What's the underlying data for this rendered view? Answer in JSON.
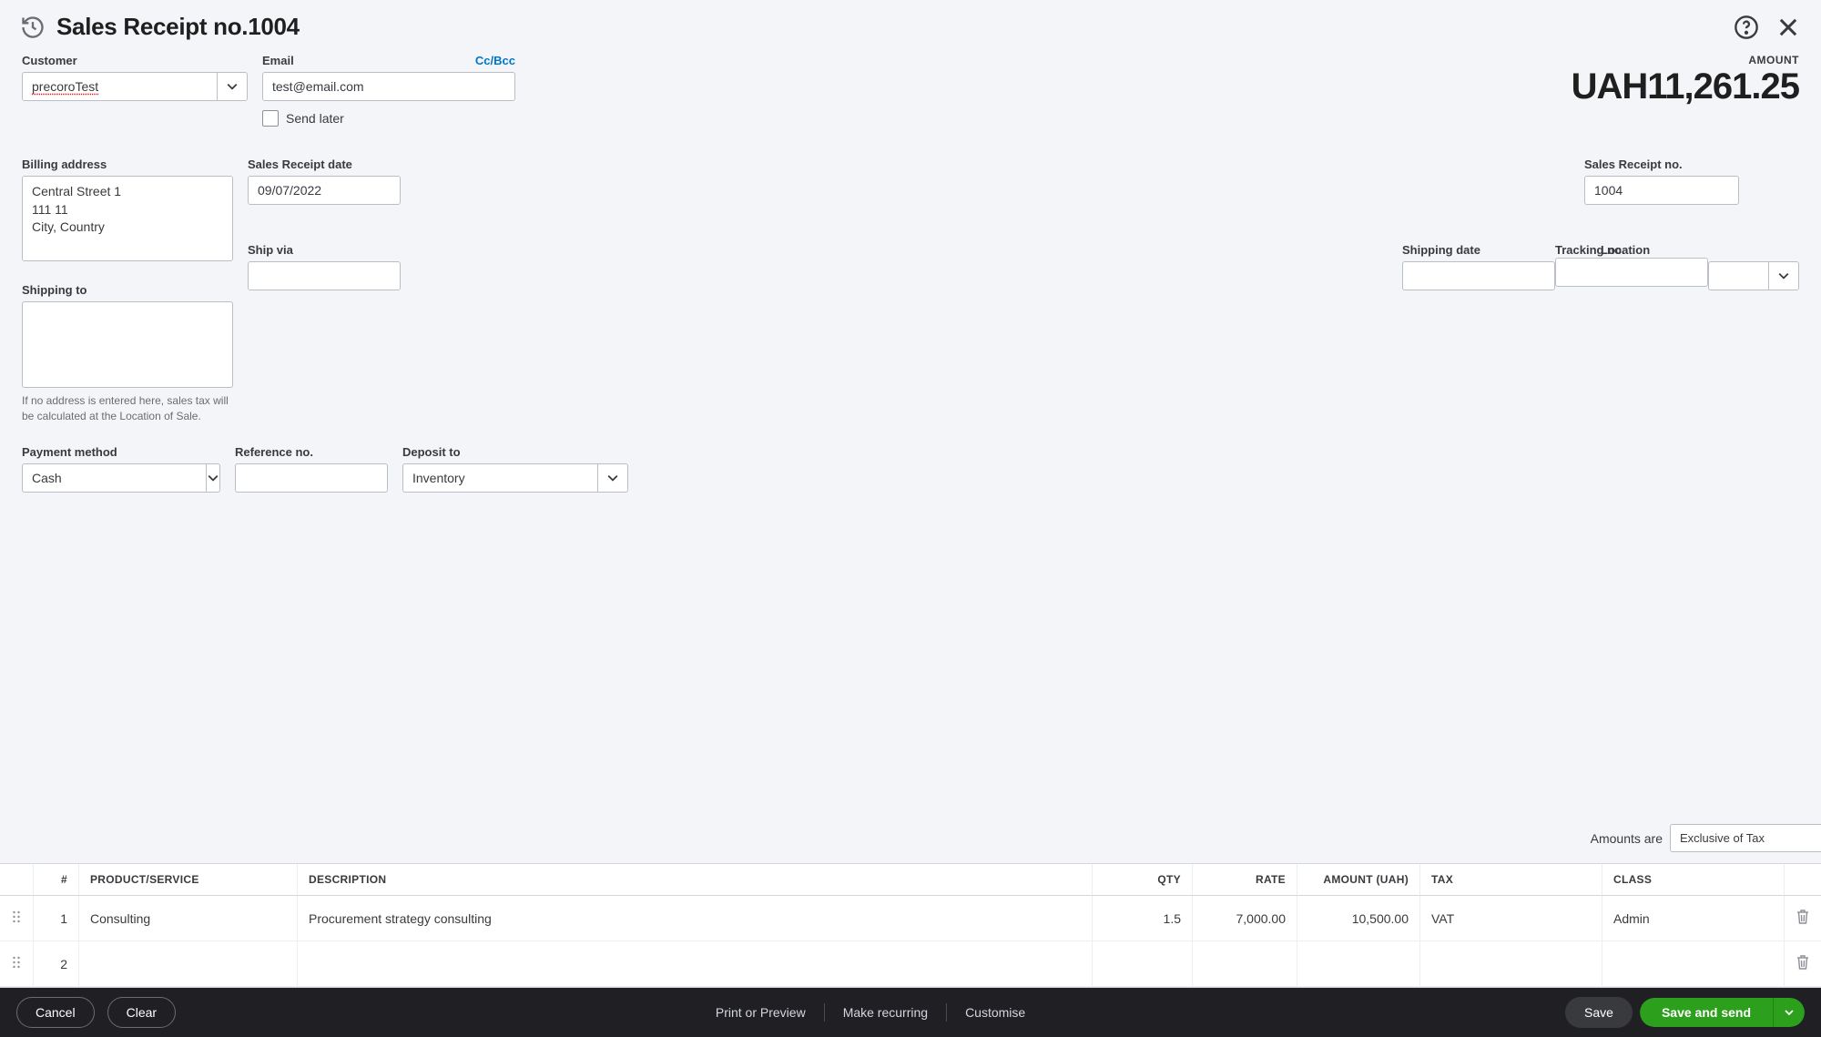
{
  "header": {
    "title": "Sales Receipt  no.1004"
  },
  "amount": {
    "label": "AMOUNT",
    "value": "UAH11,261.25"
  },
  "fields": {
    "customer_label": "Customer",
    "customer_value": "precoroTest",
    "email_label": "Email",
    "email_value": "test@email.com",
    "ccbcc": "Cc/Bcc",
    "send_later": "Send later",
    "billing_label": "Billing address",
    "billing_value": "Central Street 1\n111 11\nCity, Country",
    "shipping_to_label": "Shipping to",
    "shipping_to_value": "",
    "shipping_helper": "If no address is entered here, sales tax will be calculated at the Location of Sale.",
    "receipt_date_label": "Sales Receipt date",
    "receipt_date_value": "09/07/2022",
    "ship_via_label": "Ship via",
    "ship_via_value": "",
    "shipping_date_label": "Shipping date",
    "shipping_date_value": "",
    "tracking_label": "Tracking no.",
    "tracking_value": "",
    "location_label": "Location",
    "location_value": "",
    "receipt_no_label": "Sales Receipt no.",
    "receipt_no_value": "1004",
    "payment_method_label": "Payment method",
    "payment_method_value": "Cash",
    "reference_label": "Reference no.",
    "reference_value": "",
    "deposit_label": "Deposit to",
    "deposit_value": "Inventory"
  },
  "amounts_are": {
    "label": "Amounts are",
    "value": "Exclusive of Tax"
  },
  "table": {
    "headers": {
      "num": "#",
      "product": "PRODUCT/SERVICE",
      "description": "DESCRIPTION",
      "qty": "QTY",
      "rate": "RATE",
      "amount": "AMOUNT (UAH)",
      "tax": "TAX",
      "class": "CLASS"
    },
    "rows": [
      {
        "num": "1",
        "product": "Consulting",
        "description": "Procurement strategy consulting",
        "qty": "1.5",
        "rate": "7,000.00",
        "amount": "10,500.00",
        "tax": "VAT",
        "class": "Admin"
      },
      {
        "num": "2",
        "product": "",
        "description": "",
        "qty": "",
        "rate": "",
        "amount": "",
        "tax": "",
        "class": ""
      }
    ]
  },
  "footer": {
    "cancel": "Cancel",
    "clear": "Clear",
    "print": "Print or Preview",
    "recurring": "Make recurring",
    "customise": "Customise",
    "save": "Save",
    "save_send": "Save and send"
  }
}
